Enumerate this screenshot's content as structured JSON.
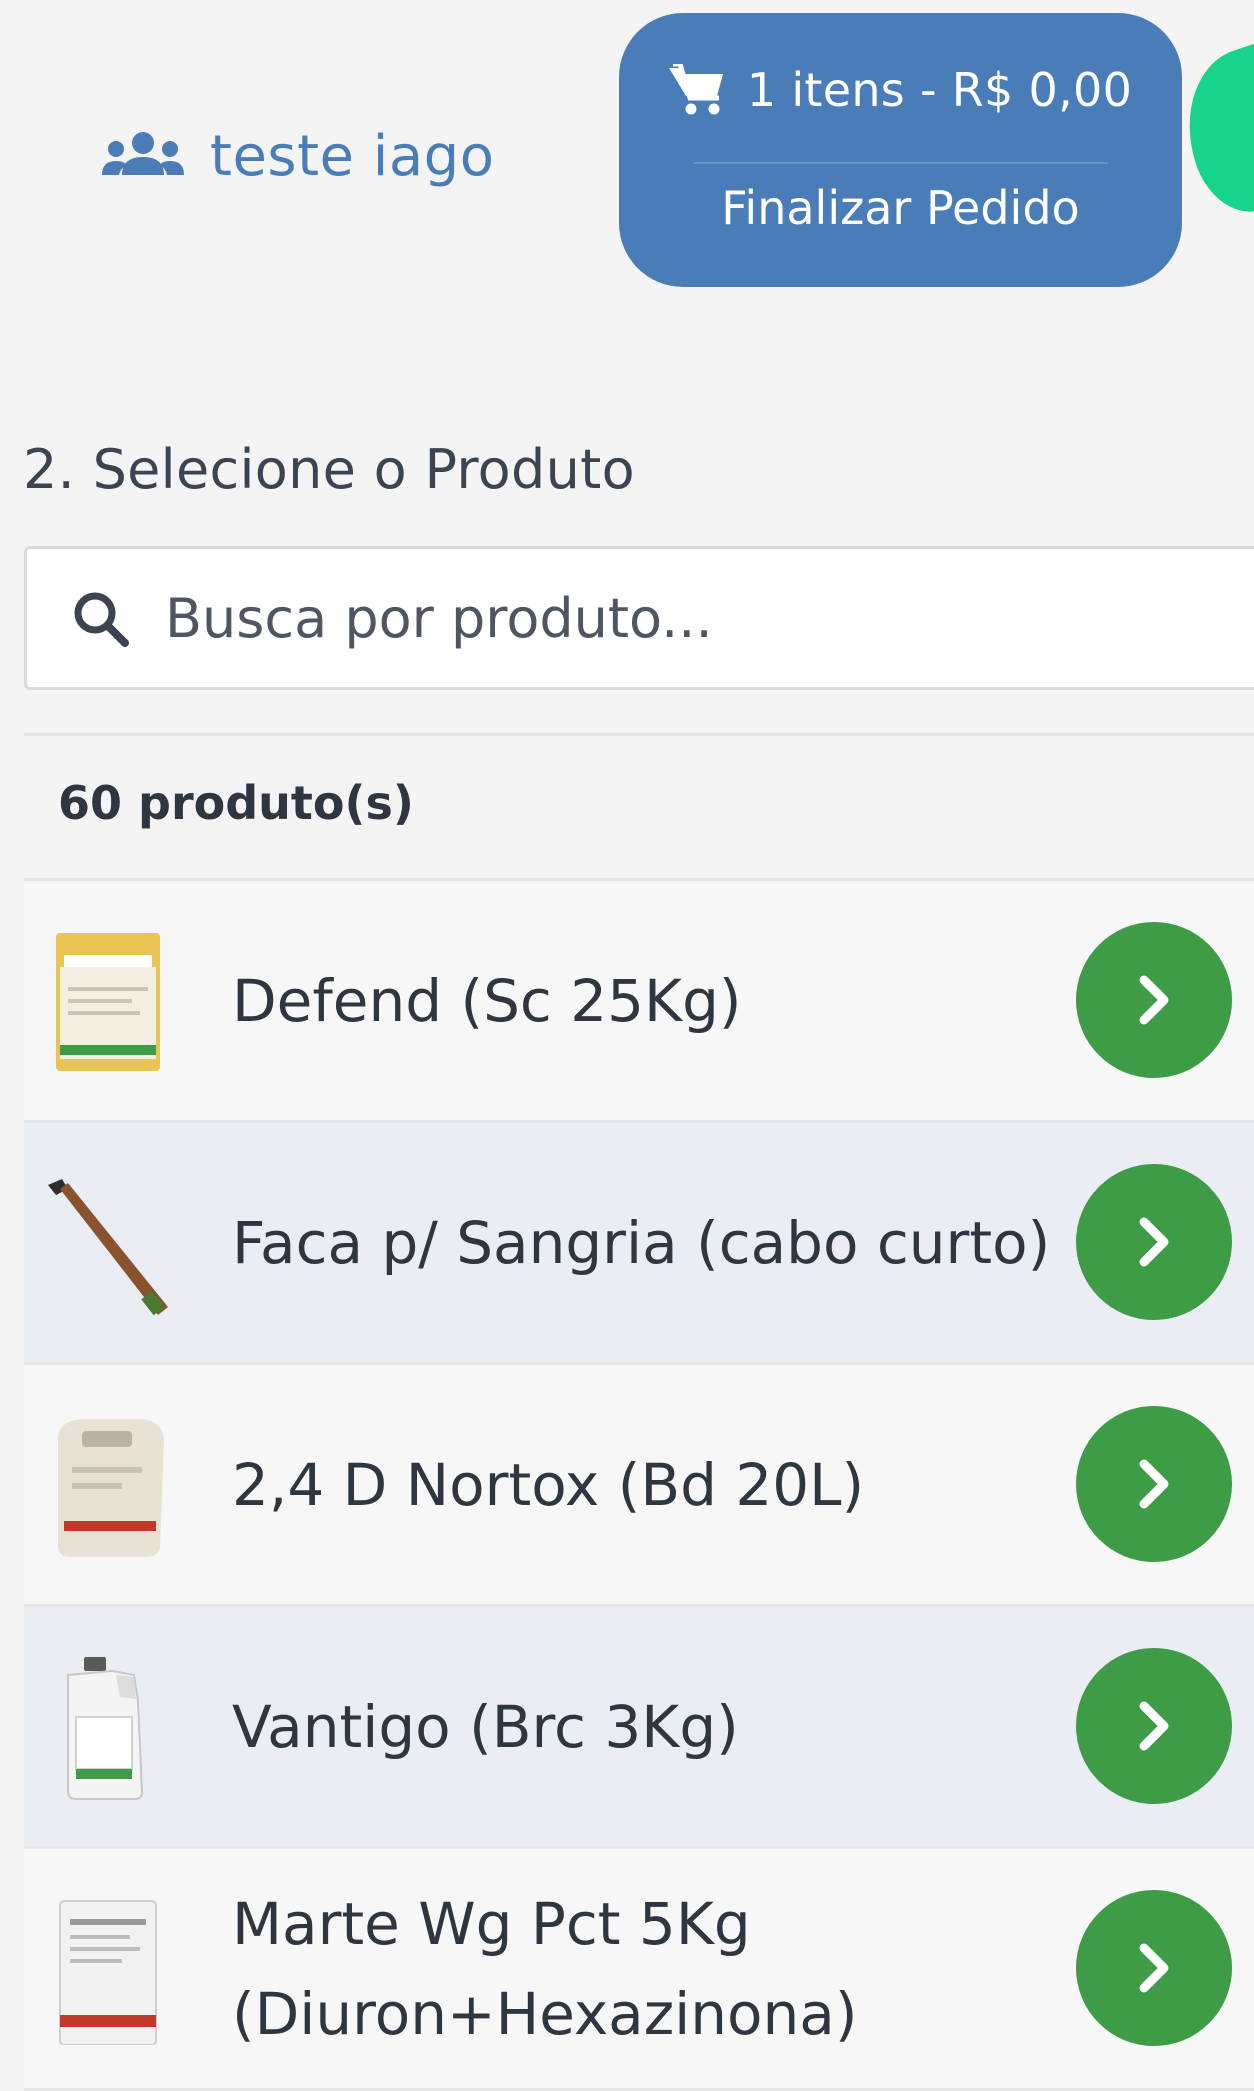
{
  "header": {
    "user_name": "teste iago",
    "user_icon": "users-icon",
    "cart": {
      "icon": "shopping-cart-icon",
      "summary": "1 itens - R$ 0,00",
      "action_label": "Finalizar Pedido"
    }
  },
  "product_section": {
    "title": "2. Selecione o Produto",
    "search": {
      "icon": "search-icon",
      "placeholder": "Busca por produto..."
    },
    "count_label": "60 produto(s)",
    "products": [
      {
        "name": "Defend (Sc 25Kg)",
        "thumb": "bag-icon"
      },
      {
        "name": "Faca p/ Sangria (cabo curto)",
        "thumb": "knife-icon"
      },
      {
        "name": "2,4 D Nortox (Bd 20L)",
        "thumb": "bucket-icon"
      },
      {
        "name": "Vantigo (Brc 3Kg)",
        "thumb": "jug-icon"
      },
      {
        "name": "Marte Wg Pct 5Kg (Diuron+Hexazinona)",
        "thumb": "package-icon"
      }
    ],
    "row_button_icon": "chevron-right-icon"
  },
  "colors": {
    "brand_blue": "#4a7db8",
    "action_green": "#3d9c45",
    "accent_green": "#17d48a"
  }
}
